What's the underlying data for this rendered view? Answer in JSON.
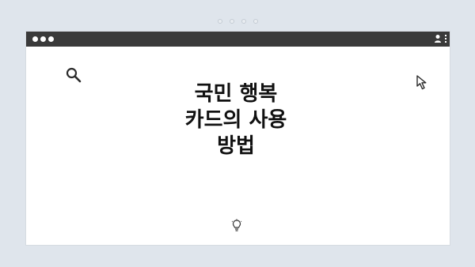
{
  "frame": {
    "top_indicator_dots": 4
  },
  "browser": {
    "window_controls": [
      "control-dot",
      "control-dot",
      "control-dot"
    ],
    "toolbar_icons": [
      "profile-icon",
      "kebab-menu-icon"
    ]
  },
  "content": {
    "title": "국민 행복\n카드의 사용\n방법",
    "icons": [
      "search-icon",
      "cursor-arrow-icon",
      "lightbulb-icon"
    ]
  }
}
